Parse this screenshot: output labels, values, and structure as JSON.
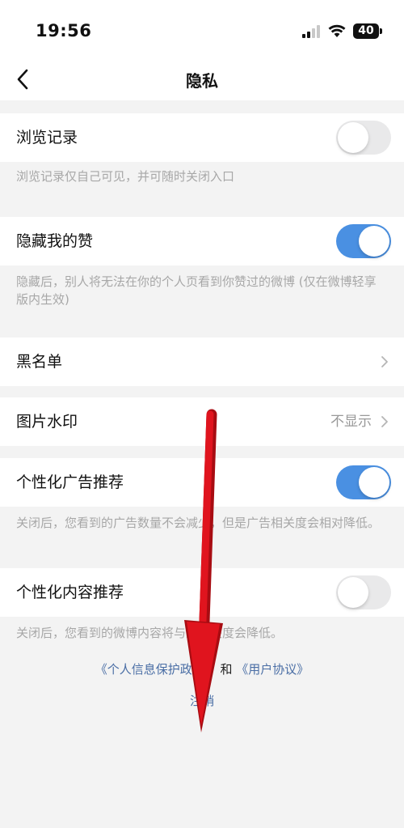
{
  "status_bar": {
    "time": "19:56",
    "battery": "40"
  },
  "nav": {
    "title": "隐私"
  },
  "rows": {
    "history": {
      "label": "浏览记录",
      "toggle_on": false,
      "desc": "浏览记录仅自己可见，并可随时关闭入口"
    },
    "hide_likes": {
      "label": "隐藏我的赞",
      "toggle_on": true,
      "desc": "隐藏后，别人将无法在你的个人页看到你赞过的微博 (仅在微博轻享版内生效)"
    },
    "blacklist": {
      "label": "黑名单"
    },
    "watermark": {
      "label": "图片水印",
      "value": "不显示"
    },
    "ads": {
      "label": "个性化广告推荐",
      "toggle_on": true,
      "desc": "关闭后，您看到的广告数量不会减少，但是广告相关度会相对降低。"
    },
    "content": {
      "label": "个性化内容推荐",
      "toggle_on": false,
      "desc": "关闭后，您看到的微博内容将与您相关度会降低。"
    }
  },
  "footer": {
    "privacy_link": "《个人信息保护政策》",
    "and": " 和 ",
    "agreement_link": "《用户协议》",
    "logout": "注销"
  },
  "colors": {
    "accent": "#4a90e2",
    "link": "#4a6ea5",
    "annotation_arrow": "#e0141e"
  }
}
